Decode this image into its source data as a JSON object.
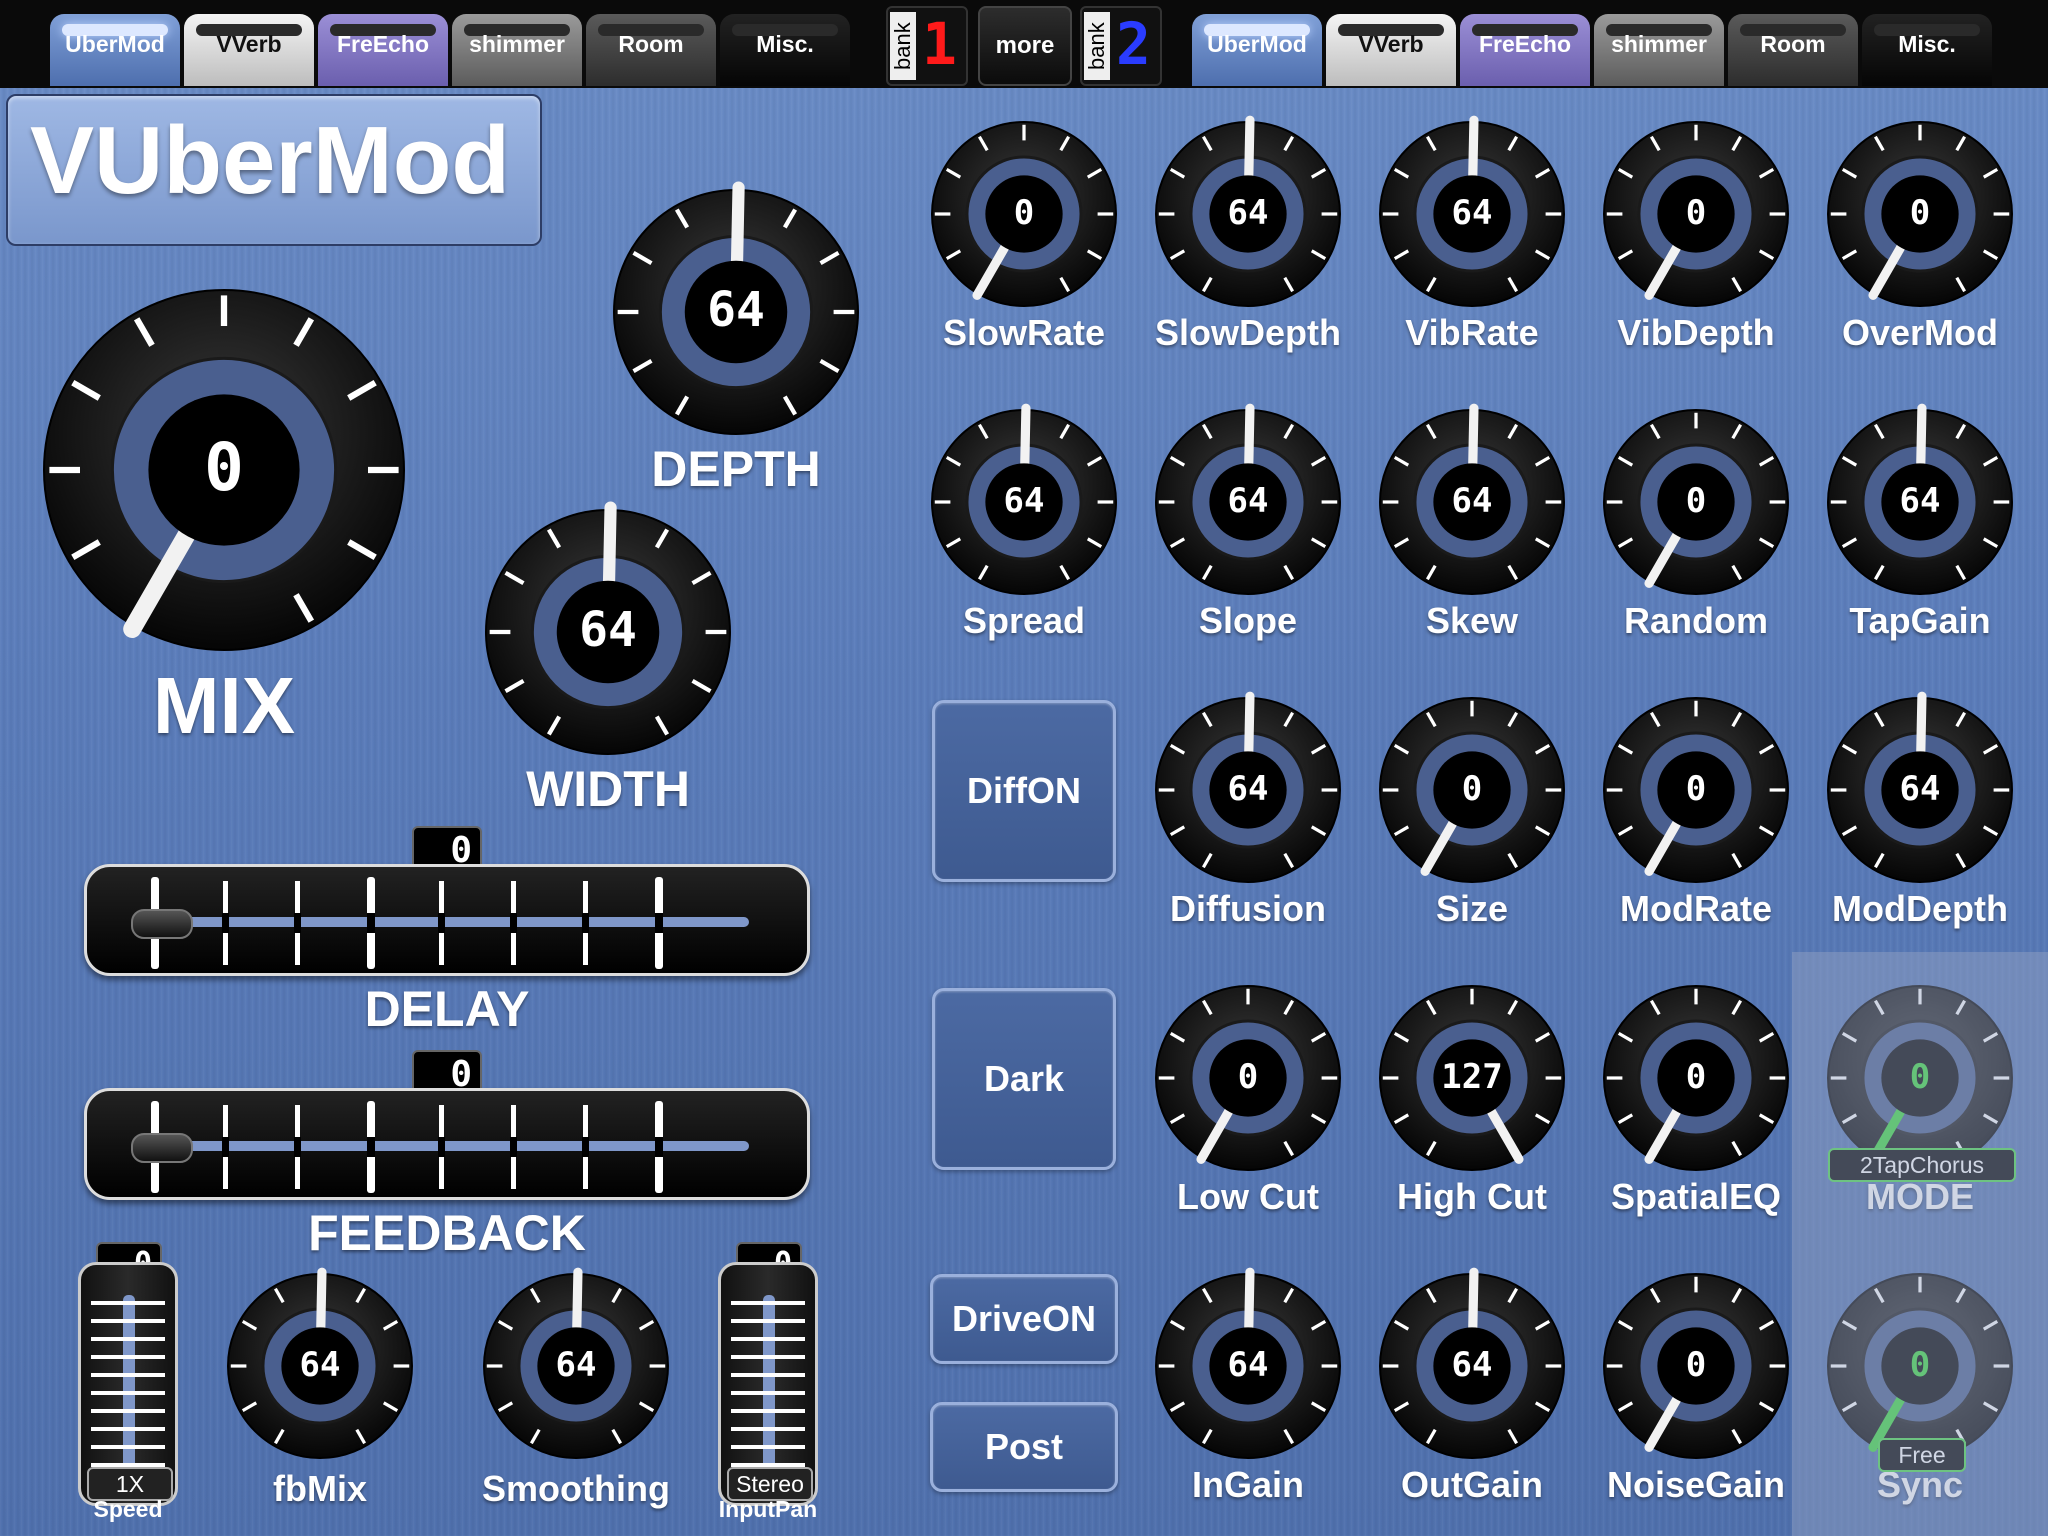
{
  "topbar": {
    "left_tabs": [
      {
        "label": "UberMod",
        "style": "t-uber",
        "active": true
      },
      {
        "label": "VVerb",
        "style": "t-vverb",
        "active": false
      },
      {
        "label": "FreEcho",
        "style": "t-free",
        "active": false
      },
      {
        "label": "shimmer",
        "style": "t-shim",
        "active": false
      },
      {
        "label": "Room",
        "style": "t-room",
        "active": false
      },
      {
        "label": "Misc.",
        "style": "t-misc",
        "active": false
      }
    ],
    "right_tabs": [
      {
        "label": "UberMod",
        "style": "t-uber",
        "active": true
      },
      {
        "label": "VVerb",
        "style": "t-vverb",
        "active": false
      },
      {
        "label": "FreEcho",
        "style": "t-free",
        "active": false
      },
      {
        "label": "shimmer",
        "style": "t-shim",
        "active": false
      },
      {
        "label": "Room",
        "style": "t-room",
        "active": false
      },
      {
        "label": "Misc.",
        "style": "t-misc",
        "active": false
      }
    ],
    "bank_label": "bank",
    "bank1_number": "1",
    "bank1_color": "#ff1a1a",
    "more_label": "more",
    "bank2_number": "2",
    "bank2_color": "#2a3cff"
  },
  "title": "VUberMod",
  "big_knobs": {
    "mix": {
      "label": "MIX",
      "value": "0",
      "level": 0
    },
    "depth": {
      "label": "DEPTH",
      "value": "64",
      "level": 64
    },
    "width": {
      "label": "WIDTH",
      "value": "64",
      "level": 64
    }
  },
  "sliders": {
    "delay": {
      "label": "DELAY",
      "value": "0"
    },
    "feedback": {
      "label": "FEEDBACK",
      "value": "0"
    }
  },
  "faders": {
    "speed": {
      "value": "0",
      "name": "1X",
      "label": "Speed"
    },
    "inputpan": {
      "value": "0",
      "name": "Stereo",
      "label": "InputPan"
    }
  },
  "small_left_knobs": {
    "fbmix": {
      "label": "fbMix",
      "value": "64",
      "level": 64
    },
    "smoothing": {
      "label": "Smoothing",
      "value": "64",
      "level": 64
    }
  },
  "buttons": {
    "diff": "DiffON",
    "dark": "Dark",
    "drive": "DriveON",
    "post": "Post"
  },
  "grid_knobs": [
    {
      "label": "SlowRate",
      "value": "0",
      "level": 0
    },
    {
      "label": "SlowDepth",
      "value": "64",
      "level": 64
    },
    {
      "label": "VibRate",
      "value": "64",
      "level": 64
    },
    {
      "label": "VibDepth",
      "value": "0",
      "level": 0
    },
    {
      "label": "OverMod",
      "value": "0",
      "level": 0
    },
    {
      "label": "Spread",
      "value": "64",
      "level": 64
    },
    {
      "label": "Slope",
      "value": "64",
      "level": 64
    },
    {
      "label": "Skew",
      "value": "64",
      "level": 64
    },
    {
      "label": "Random",
      "value": "0",
      "level": 0
    },
    {
      "label": "TapGain",
      "value": "64",
      "level": 64
    },
    {
      "label": "Diffusion",
      "value": "64",
      "level": 64
    },
    {
      "label": "Size",
      "value": "0",
      "level": 0
    },
    {
      "label": "ModRate",
      "value": "0",
      "level": 0
    },
    {
      "label": "ModDepth",
      "value": "64",
      "level": 64
    },
    {
      "label": "Low Cut",
      "value": "0",
      "level": 0
    },
    {
      "label": "High Cut",
      "value": "127",
      "level": 127
    },
    {
      "label": "SpatialEQ",
      "value": "0",
      "level": 0
    },
    {
      "label": "InGain",
      "value": "64",
      "level": 64
    },
    {
      "label": "OutGain",
      "value": "64",
      "level": 64
    },
    {
      "label": "NoiseGain",
      "value": "0",
      "level": 0
    }
  ],
  "mode": {
    "label": "MODE",
    "value": "0",
    "tag": "2TapChorus",
    "level": 0
  },
  "sync": {
    "label": "Sync",
    "value": "0",
    "tag": "Free",
    "level": 0
  },
  "colors": {
    "pointer_green": "#3ddc3d",
    "ring_blue": "#4a5f8f",
    "bg_blue": "#5a7cba"
  }
}
